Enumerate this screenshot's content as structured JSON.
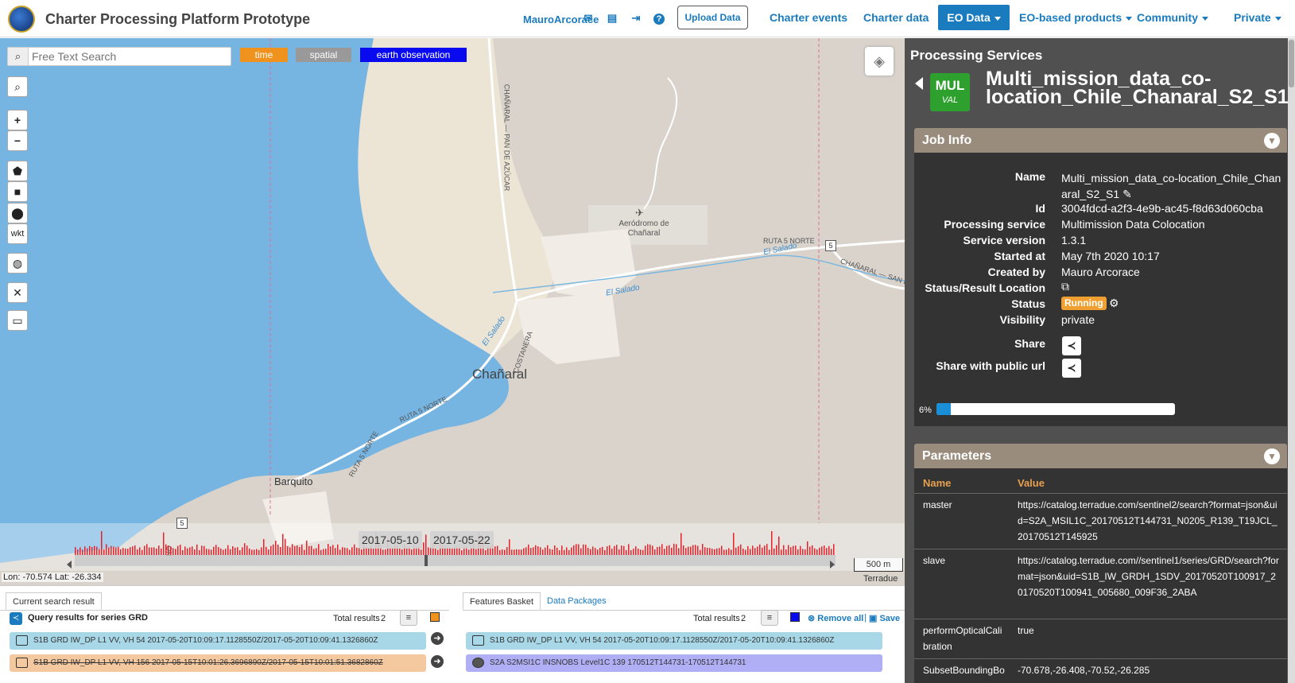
{
  "app": {
    "title": "Charter Processing Platform Prototype"
  },
  "nav": {
    "user": "MauroArcorace",
    "upload": "Upload Data",
    "items": [
      "Charter events",
      "Charter data",
      "EO Data",
      "EO-based products",
      "Community",
      "Private"
    ]
  },
  "search": {
    "placeholder": "Free Text Search",
    "chips": [
      "time",
      "spatial",
      "earth observation"
    ]
  },
  "map_tools": [
    "wkt"
  ],
  "map": {
    "labels": [
      "Chañaral",
      "Barquito",
      "Aeródromo de Chañaral",
      "El Salado",
      "COSTANERA",
      "RUTA 5 NORTE",
      "CHAÑARAL — PAN DE AZÚCAR",
      "CHAÑARAL — SAN MA",
      "5",
      "5",
      "NO"
    ],
    "coords": "Lon: -70.574 Lat: -26.334",
    "scale": "500 m",
    "attribution": "Terradue",
    "timeline_dates": [
      "2017-05-10",
      "2017-05-22"
    ]
  },
  "colors": {
    "time_chip": "#f0921e",
    "spatial_chip": "#999999",
    "eo_chip": "#0a0af0",
    "accent": "#1a7bbf",
    "running": "#f0a030",
    "mul_badge": "#2ea02e"
  },
  "left_panel": {
    "tab": "Current search result",
    "query": "Query results for series GRD",
    "total_label": "Total results",
    "total": "2",
    "rows": [
      "S1B GRD IW_DP L1 VV, VH 54 2017-05-20T10:09:17.1128550Z/2017-05-20T10:09:41.1326860Z",
      "S1B GRD IW_DP L1 VV, VH 156 2017-05-15T10:01:26.3696890Z/2017-05-15T10:01:51.3682860Z"
    ]
  },
  "right_bottom": {
    "tabs": [
      "Features Basket",
      "Data Packages"
    ],
    "total_label": "Total results",
    "total": "2",
    "remove_all": "Remove all",
    "save": "Save",
    "rows": [
      "S1B GRD IW_DP L1 VV, VH 54 2017-05-20T10:09:17.1128550Z/2017-05-20T10:09:41.1326860Z",
      "S2A S2MSI1C INSNOBS Level1C 139 170512T144731-170512T144731"
    ]
  },
  "processing": {
    "title": "Processing Services",
    "badge_top": "MUL",
    "badge_bottom": "VAL",
    "job_title": "Multi_mission_data_co-location_Chile_Chanaral_S2_S1",
    "job_info_label": "Job Info",
    "fields": {
      "name_k": "Name",
      "name_v": "Multi_mission_data_co-location_Chile_Chanaral_S2_S1",
      "id_k": "Id",
      "id_v": "3004fdcd-a2f3-4e9b-ac45-f8d63d060cba",
      "service_k": "Processing service",
      "service_v": "Multimission Data Colocation",
      "version_k": "Service version",
      "version_v": "1.3.1",
      "started_k": "Started at",
      "started_v": "May 7th 2020 10:17",
      "created_k": "Created by",
      "created_v": "Mauro Arcorace",
      "location_k": "Status/Result Location",
      "status_k": "Status",
      "status_v": "Running",
      "visibility_k": "Visibility",
      "visibility_v": "private",
      "share_k": "Share",
      "public_k": "Share with public url"
    },
    "progress_label": "6%",
    "progress": 0.06,
    "params_label": "Parameters",
    "params_head": [
      "Name",
      "Value"
    ],
    "params": [
      {
        "name": "master",
        "value": "https://catalog.terradue.com/sentinel2/search?format=json&uid=S2A_MSIL1C_20170512T144731_N0205_R139_T19JCL_20170512T145925"
      },
      {
        "name": "slave",
        "value": "https://catalog.terradue.com//sentinel1/series/GRD/search?format=json&uid=S1B_IW_GRDH_1SDV_20170520T100917_20170520T100941_005680_009F36_2ABA"
      },
      {
        "name": "performOpticalCalibration",
        "value": "true"
      },
      {
        "name": "SubsetBoundingBo",
        "value": "-70.678,-26.408,-70.52,-26.285"
      }
    ]
  }
}
